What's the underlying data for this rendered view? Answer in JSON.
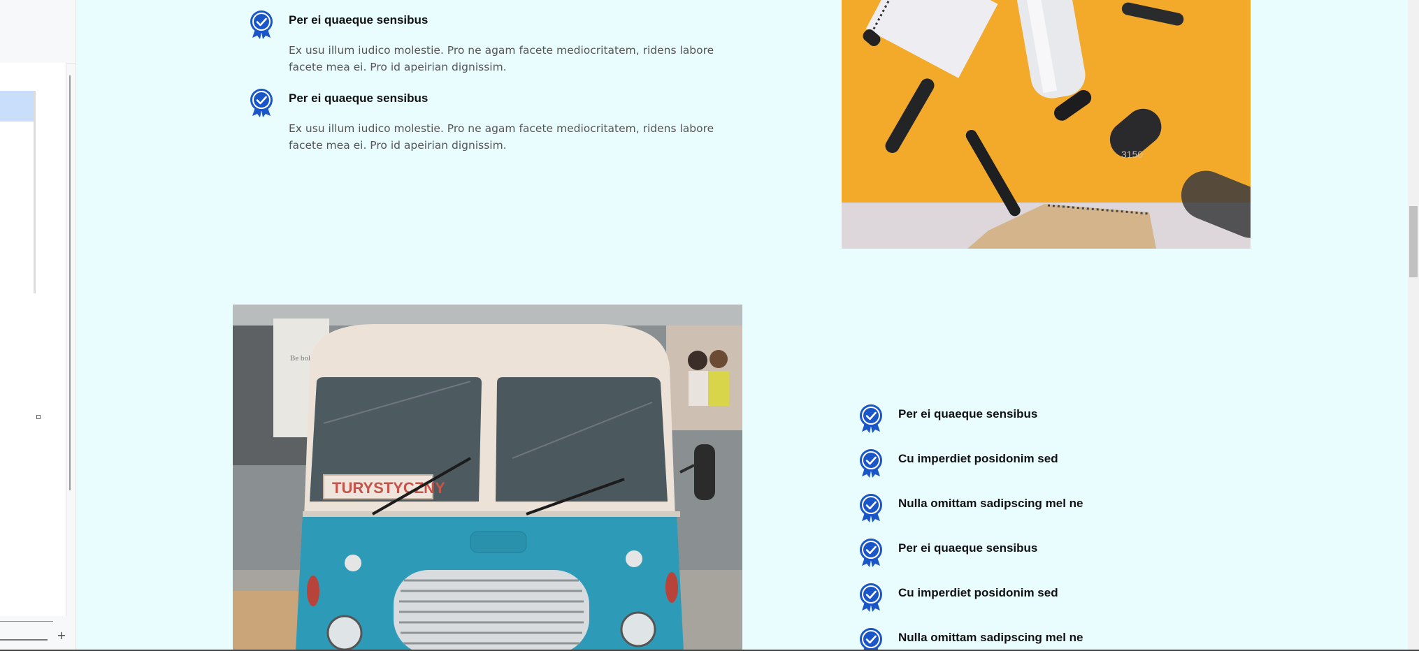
{
  "features_top": [
    {
      "title": "Per ei quaeque sensibus",
      "description": "Ex usu illum iudico molestie. Pro ne agam facete mediocritatem, ridens labore facete mea ei. Pro id apeirian dignissim."
    },
    {
      "title": "Per ei quaeque sensibus",
      "description": "Ex usu illum iudico molestie. Pro ne agam facete mediocritatem, ridens labore facete mea ei. Pro id apeirian dignissim."
    }
  ],
  "features_list": [
    {
      "title": "Per ei quaeque sensibus"
    },
    {
      "title": "Cu imperdiet posidonim sed"
    },
    {
      "title": "Nulla omittam sadipscing mel ne"
    },
    {
      "title": "Per ei quaeque sensibus"
    },
    {
      "title": "Cu imperdiet posidonim sed"
    },
    {
      "title": "Nulla omittam sadipscing mel ne"
    }
  ],
  "images": {
    "pens": {
      "marker_label": "3150"
    },
    "bus": {
      "sign_text": "TURYSTYCZNY",
      "billboard_text": "Be bold\nBe true\nBe you"
    }
  },
  "colors": {
    "background": "#e9fdfe",
    "badge": "#1b56c9",
    "title_text": "#111111",
    "body_text": "#555555"
  },
  "icons": {
    "feature_badge": "award-check-icon",
    "add": "plus-icon"
  },
  "side_panel": {
    "add_glyph": "+"
  }
}
